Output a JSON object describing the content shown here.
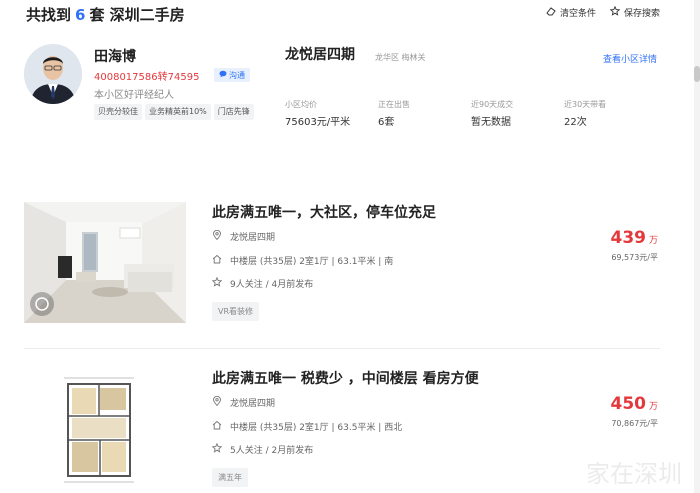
{
  "header": {
    "prefix": "共找到",
    "count": "6",
    "suffix": "套 深圳二手房",
    "clear_label": "清空条件",
    "save_label": "保存搜索"
  },
  "agent": {
    "name": "田海博",
    "phone": "4008017586转74595",
    "chat_label": "沟通",
    "desc": "本小区好评经纪人",
    "tags": [
      "贝壳分较佳",
      "业务精英前10%",
      "门店先锋"
    ]
  },
  "community": {
    "name": "龙悦居四期",
    "location": "龙华区  梅林关",
    "detail_link": "查看小区详情",
    "stats": [
      {
        "label": "小区均价",
        "value": "75603元/平米"
      },
      {
        "label": "正在出售",
        "value": "6套"
      },
      {
        "label": "近90天成交",
        "value": "暂无数据"
      },
      {
        "label": "近30天带看",
        "value": "22次"
      }
    ]
  },
  "listings": [
    {
      "title": "此房满五唯一，大社区，停车位充足",
      "community": "龙悦居四期",
      "info": "中楼层 (共35层) 2室1厅 | 63.1平米 | 南",
      "follow": "9人关注 / 4月前发布",
      "badge": "VR看装修",
      "price": "439",
      "price_unit_label": "万",
      "unit_price": "69,573元/平"
    },
    {
      "title": "此房满五唯一 税费少 ，中间楼层 看房方便",
      "community": "龙悦居四期",
      "info": "中楼层 (共35层) 2室1厅 | 63.5平米 | 西北",
      "follow": "5人关注 / 2月前发布",
      "badge": "满五年",
      "price": "450",
      "price_unit_label": "万",
      "unit_price": "70,867元/平"
    }
  ],
  "watermark": "家在深圳",
  "colors": {
    "accent": "#3072f6",
    "price": "#e4393c"
  }
}
